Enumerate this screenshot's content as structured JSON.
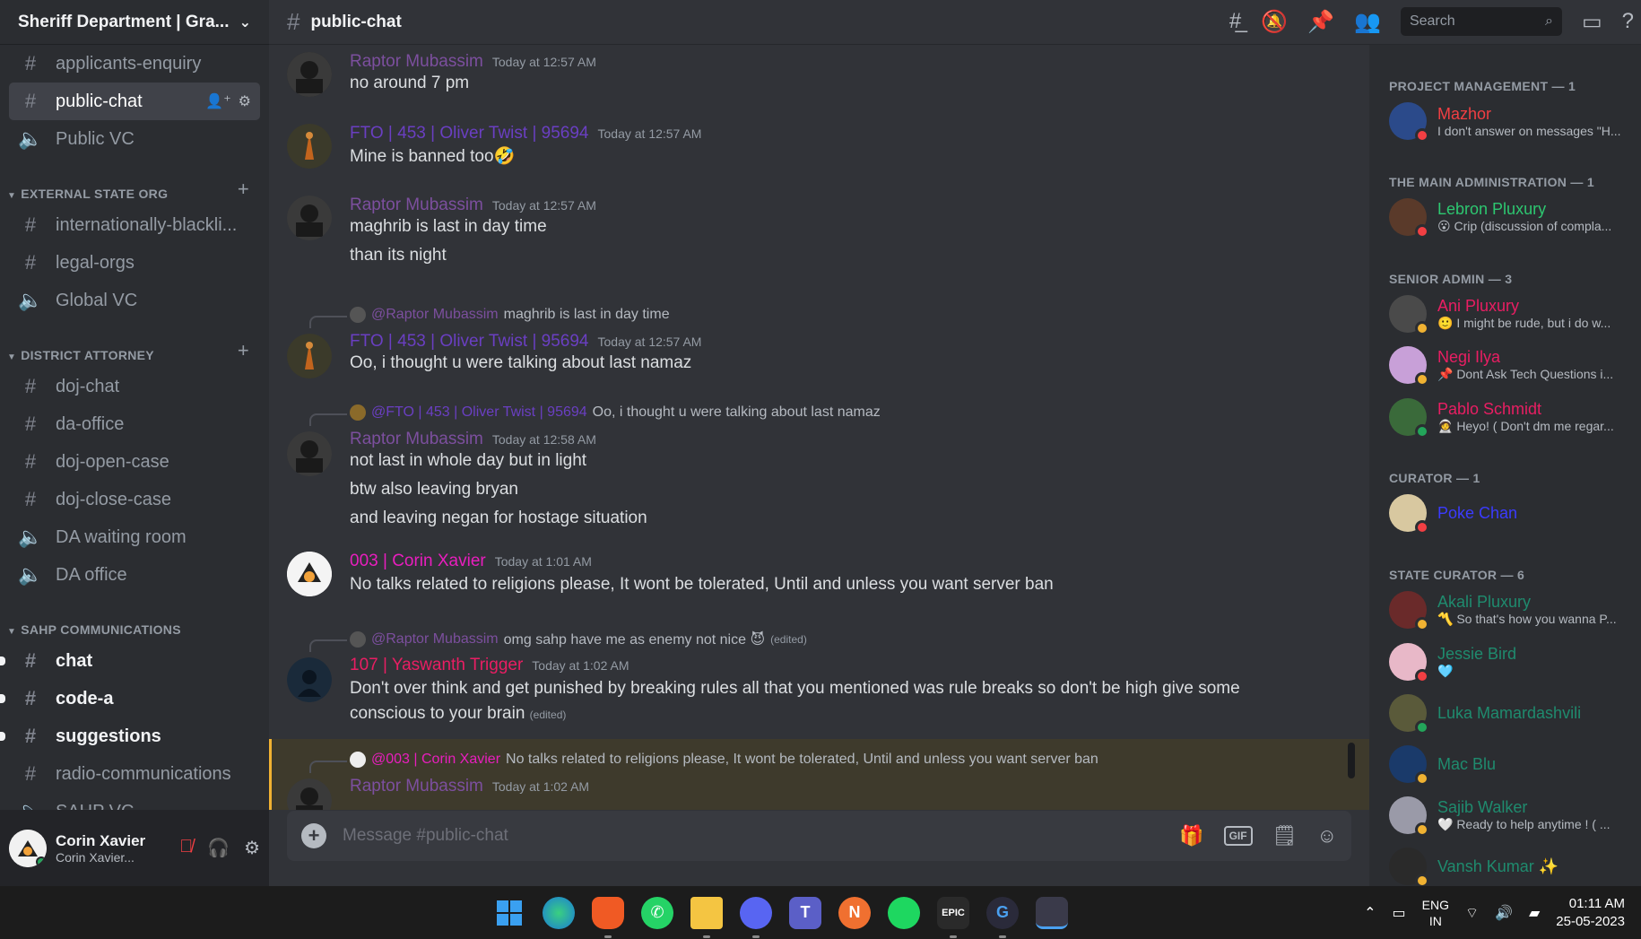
{
  "server": {
    "name": "Sheriff Department | Gra..."
  },
  "sidebar": {
    "top_channels": [
      {
        "label": "applicants-enquiry",
        "type": "text"
      },
      {
        "label": "public-chat",
        "type": "text",
        "active": true
      },
      {
        "label": "Public VC",
        "type": "voice"
      }
    ],
    "categories": [
      {
        "name": "EXTERNAL STATE ORG",
        "channels": [
          {
            "label": "internationally-blackli...",
            "type": "text"
          },
          {
            "label": "legal-orgs",
            "type": "text"
          },
          {
            "label": "Global VC",
            "type": "voice"
          }
        ]
      },
      {
        "name": "DISTRICT ATTORNEY",
        "channels": [
          {
            "label": "doj-chat",
            "type": "text"
          },
          {
            "label": "da-office",
            "type": "text"
          },
          {
            "label": "doj-open-case",
            "type": "text"
          },
          {
            "label": "doj-close-case",
            "type": "text"
          },
          {
            "label": "DA waiting room",
            "type": "voice"
          },
          {
            "label": "DA office",
            "type": "voice"
          }
        ]
      },
      {
        "name": "SAHP COMMUNICATIONS",
        "channels": [
          {
            "label": "chat",
            "type": "text",
            "unread": true
          },
          {
            "label": "code-a",
            "type": "text",
            "unread": true
          },
          {
            "label": "suggestions",
            "type": "text",
            "unread": true
          },
          {
            "label": "radio-communications",
            "type": "text"
          },
          {
            "label": "SAHP VC",
            "type": "voice"
          }
        ]
      }
    ]
  },
  "user_panel": {
    "name": "Corin Xavier",
    "sub": "Corin Xavier..."
  },
  "channel": {
    "name": "public-chat"
  },
  "search": {
    "placeholder": "Search"
  },
  "messages": {
    "m1": {
      "author": "Raptor Mubassim",
      "time": "Today at 12:57 AM",
      "lines": [
        "no around 7 pm"
      ]
    },
    "m2": {
      "author": "FTO | 453 | Oliver Twist | 95694",
      "time": "Today at 12:57 AM",
      "lines": [
        "Mine is banned too🤣"
      ]
    },
    "m3": {
      "author": "Raptor Mubassim",
      "time": "Today at 12:57 AM",
      "lines": [
        "maghrib is last in day time",
        "than its night"
      ]
    },
    "m4": {
      "reply_to": "@Raptor Mubassim",
      "reply_text": "maghrib is last in day time",
      "author": "FTO | 453 | Oliver Twist | 95694",
      "time": "Today at 12:57 AM",
      "lines": [
        "Oo, i thought u were talking about last namaz"
      ]
    },
    "m5": {
      "reply_to": "@FTO | 453 | Oliver Twist | 95694",
      "reply_text": "Oo, i thought u were talking about last namaz",
      "author": "Raptor Mubassim",
      "time": "Today at 12:58 AM",
      "lines": [
        "not last in whole day but in light",
        "btw also leaving bryan",
        "and leaving negan for hostage situation"
      ]
    },
    "m6": {
      "author": "003 | Corin Xavier",
      "time": "Today at 1:01 AM",
      "lines": [
        "No talks related to religions please, It wont be tolerated, Until and unless you want server ban"
      ]
    },
    "m7": {
      "reply_to": "@Raptor Mubassim",
      "reply_text": "omg sahp have me as enemy not nice 😈",
      "reply_edited": "(edited)",
      "author": "107 | Yaswanth Trigger",
      "time": "Today at 1:02 AM",
      "lines": [
        "Don't over think and get punished by breaking rules all that you mentioned was rule breaks so don't be high give some",
        "conscious to your brain"
      ],
      "edited": "(edited)"
    },
    "m8": {
      "reply_to": "@003 | Corin Xavier",
      "reply_text": "No talks related to religions please, It wont be tolerated, Until and unless you want server ban",
      "author": "Raptor Mubassim",
      "time": "Today at 1:02 AM"
    }
  },
  "composer": {
    "placeholder": "Message #public-chat",
    "gif": "GIF"
  },
  "members": {
    "roles": [
      {
        "name": "PROJECT MANAGEMENT — 1"
      },
      {
        "name": "THE MAIN ADMINISTRATION — 1"
      },
      {
        "name": "SENIOR ADMIN — 3"
      },
      {
        "name": "CURATOR — 1"
      },
      {
        "name": "STATE CURATOR — 6"
      }
    ],
    "list": [
      {
        "name": "Mazhor",
        "status": "I don't answer on messages \"H...",
        "color": "#f23f43"
      },
      {
        "name": "Lebron Pluxury",
        "status": "😮 Crip (discussion of compla...",
        "color": "#2dc770"
      },
      {
        "name": "Ani Pluxury",
        "status": "🙂 I might be rude, but i do w...",
        "color": "#e91e63"
      },
      {
        "name": "Negi Ilya",
        "status": "📌 Dont Ask Tech Questions i...",
        "color": "#e91e63"
      },
      {
        "name": "Pablo Schmidt",
        "status": "🧑‍🚀 Heyo! ( Don't dm me regar...",
        "color": "#e91e63"
      },
      {
        "name": "Poke Chan",
        "status": "",
        "color": "#3b3bff"
      },
      {
        "name": "Akali Pluxury",
        "status": "〽️ So that's how you wanna P...",
        "color": "#1f8b6e"
      },
      {
        "name": "Jessie Bird",
        "status": "🩵",
        "color": "#1f8b6e"
      },
      {
        "name": "Luka Mamardashvili",
        "status": "",
        "color": "#1f8b6e"
      },
      {
        "name": "Mac Blu",
        "status": "",
        "color": "#1f8b6e"
      },
      {
        "name": "Sajib Walker",
        "status": "🤍 Ready to help anytime ! ( ...",
        "color": "#1f8b6e"
      },
      {
        "name": "Vansh Kumar ✨",
        "status": "",
        "color": "#1f8b6e"
      }
    ]
  },
  "taskbar": {
    "lang1": "ENG",
    "lang2": "IN",
    "time": "01:11 AM",
    "date": "25-05-2023",
    "epic_label": "EPIC"
  },
  "colors": {
    "raptor": "#7c4f9e",
    "oliver": "#6a3fc2",
    "corin": "#e91ebe",
    "yaswanth": "#e91e63"
  }
}
